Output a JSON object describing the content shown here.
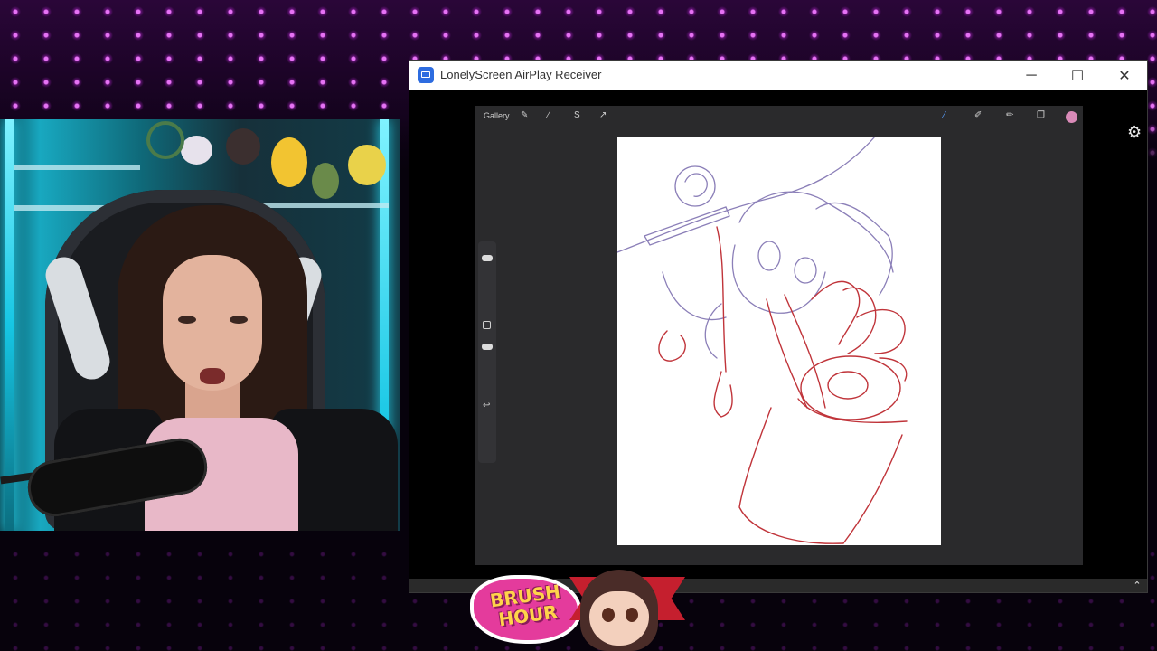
{
  "window": {
    "title": "LonelyScreen AirPlay Receiver",
    "minimize_glyph": "─",
    "maximize_glyph": "☐",
    "close_glyph": "✕",
    "settings_glyph": "⚙",
    "scroll_up_glyph": "⌃"
  },
  "procreate": {
    "gallery_label": "Gallery",
    "left_tools": [
      "wrench-icon",
      "magic-wand-icon",
      "selection-icon",
      "transform-icon"
    ],
    "left_tool_glyphs": [
      "✎",
      "⁄",
      "S",
      "↗"
    ],
    "right_tools": [
      "brush-icon",
      "smudge-icon",
      "eraser-icon",
      "layers-icon"
    ],
    "right_tool_glyphs": [
      "∕",
      "✐",
      "✏",
      "❐"
    ],
    "active_color": "#d98ab8",
    "undo_glyph": "↩"
  },
  "logo": {
    "line1": "BRUSH",
    "line2": "HOUR"
  },
  "colors": {
    "sketch_purple": "#8b7fb8",
    "sketch_red": "#c0343a",
    "accent_magenta": "#e43b9c"
  }
}
